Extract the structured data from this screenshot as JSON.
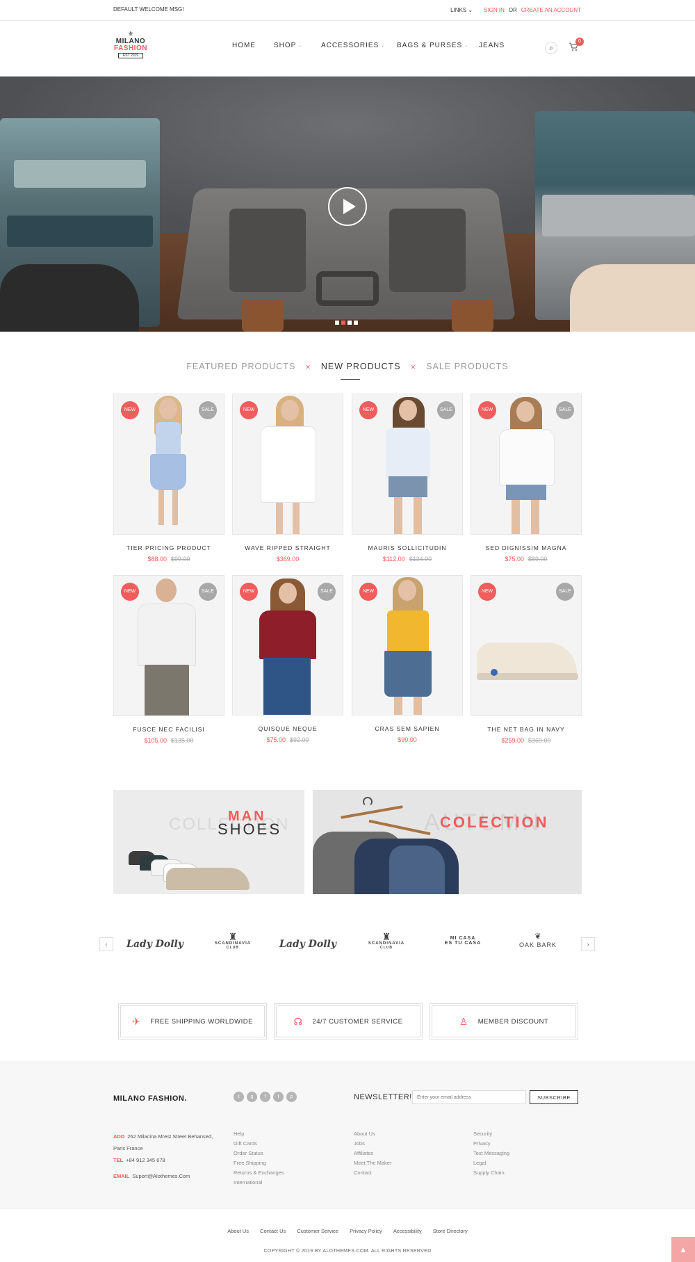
{
  "topbar": {
    "welcome": "DEFAULT WELCOME MSG!",
    "links": "LINKS",
    "sign_in": "SIGN IN",
    "or": "OR",
    "create_account": "CREATE AN ACCOUNT"
  },
  "logo": {
    "line1": "MILANO",
    "line2": "FASHION",
    "line3": "EST 2019"
  },
  "nav": {
    "items": [
      "HOME",
      "SHOP",
      "ACCESSORIES",
      "BAGS & PURSES",
      "JEANS"
    ],
    "cart_count": "0"
  },
  "tabs": {
    "featured": "FEATURED PRODUCTS",
    "new": "NEW PRODUCTS",
    "sale": "SALE PRODUCTS"
  },
  "badges": {
    "new": "NEW",
    "sale": "SALE"
  },
  "products": [
    {
      "name": "TIER PRICING PRODUCT",
      "price": "$88.00",
      "old_price": "$99.00"
    },
    {
      "name": "WAVE RIPPED STRAIGHT",
      "price": "$369.00",
      "old_price": ""
    },
    {
      "name": "MAURIS SOLLICITUDIN",
      "price": "$112.00",
      "old_price": "$134.00"
    },
    {
      "name": "SED DIGNISSIM MAGNA",
      "price": "$75.00",
      "old_price": "$89.00"
    },
    {
      "name": "FUSCE NEC FACILISI",
      "price": "$105.00",
      "old_price": "$135.00"
    },
    {
      "name": "QUISQUE NEQUE",
      "price": "$75.00",
      "old_price": "$92.00"
    },
    {
      "name": "CRAS SEM SAPIEN",
      "price": "$99.00",
      "old_price": ""
    },
    {
      "name": "THE NET BAG IN NAVY",
      "price": "$259.00",
      "old_price": "$369.00"
    }
  ],
  "banners": {
    "b1_ghost": "COLLECTION",
    "b1_man": "MAN",
    "b1_shoes": "SHOES",
    "b2_ghost": "AUTUMN",
    "b2_col": "COLECTION"
  },
  "brands": {
    "lady_dolly": "Lady Dolly",
    "scandinavia": "SCANDINAVIA",
    "club": "CLUB",
    "micasa1": "MI CASA",
    "micasa2": "ES TU CASA",
    "oak": "OAK BARK"
  },
  "features": {
    "shipping": "FREE SHIPPING WORLDWIDE",
    "service": "24/7 CUSTOMER SERVICE",
    "discount": "MEMBER DISCOUNT"
  },
  "footer": {
    "brand": "MILANO FASHION.",
    "newsletter": "NEWSLETTER!",
    "email_placeholder": "Enter your email address",
    "subscribe": "SUBSCRIBE",
    "add_label": "ADD",
    "address1": "262 Milacina Mrest Street Behansed,",
    "address2": "Paris France",
    "tel_label": "TEL",
    "tel": "+84 912 345 678",
    "email_label": "EMAIL",
    "email": "Suport@Alothemes.Com",
    "col1": [
      "Help",
      "Gift Cards",
      "Order Status",
      "Free Shipping",
      "Returns & Exchanges",
      "International"
    ],
    "col2": [
      "About Us",
      "Jobs",
      "Affiliates",
      "Meet The Maker",
      "Contact"
    ],
    "col3": [
      "Security",
      "Privacy",
      "Text Messaging",
      "Legal",
      "Supply Chain"
    ]
  },
  "bottom": {
    "links": [
      "About Us",
      "Contact Us",
      "Customer Service",
      "Privacy Policy",
      "Accessibility",
      "Store Directory"
    ],
    "copyright": "COPYRIGHT © 2019 BY ALOTHEMES.COM. ALL RIGHTS RESERVED"
  },
  "colors": {
    "accent": "#f15c5c",
    "sale_badge": "#a8a8a8"
  },
  "icons": [
    "search-icon",
    "cart-icon",
    "play-icon",
    "plane-icon",
    "headset-icon",
    "user-icon",
    "twitter-icon",
    "google-plus-icon",
    "facebook-icon",
    "tumblr-icon",
    "pinterest-icon",
    "chevron-left-icon",
    "chevron-right-icon",
    "arrow-up-icon"
  ]
}
